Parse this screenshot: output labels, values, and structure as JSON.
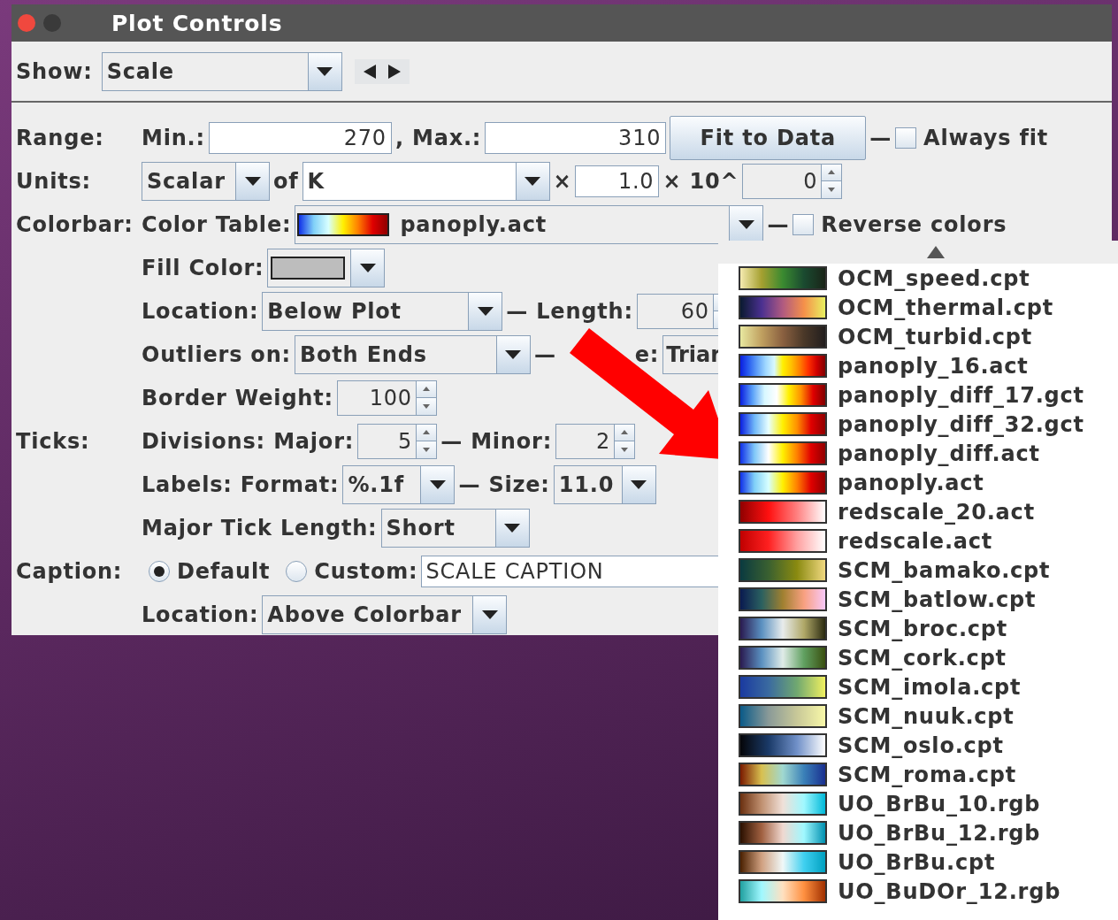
{
  "window": {
    "title": "Plot Controls"
  },
  "show": {
    "label": "Show:",
    "value": "Scale"
  },
  "rows": [
    {
      "label": "Range:",
      "items": [
        {
          "kind": "text",
          "text": "Min.:"
        },
        {
          "kind": "field",
          "value": "270"
        },
        {
          "kind": "text",
          "text": ", Max.:"
        },
        {
          "kind": "field",
          "value": "310"
        },
        {
          "kind": "button",
          "text": "Fit to Data"
        },
        {
          "kind": "text",
          "text": "—"
        },
        {
          "kind": "checkbox",
          "text": "Always fit",
          "checked": false
        }
      ]
    },
    {
      "label": "Units:",
      "items": [
        {
          "kind": "combo",
          "value": "Scalar"
        },
        {
          "kind": "text",
          "text": "of"
        },
        {
          "kind": "editcombo",
          "value": "K"
        },
        {
          "kind": "text",
          "text": "×"
        },
        {
          "kind": "field",
          "value": "1.0"
        },
        {
          "kind": "text",
          "text": "× 10^"
        },
        {
          "kind": "spinner",
          "value": "0"
        }
      ]
    },
    {
      "label": "Colorbar:",
      "items": [
        {
          "kind": "text",
          "text": "Color Table:"
        },
        {
          "kind": "tablecombo",
          "value": "panoply.act"
        },
        {
          "kind": "text",
          "text": "—"
        },
        {
          "kind": "checkbox",
          "text": "Reverse colors",
          "checked": false
        }
      ]
    },
    {
      "items": [
        {
          "kind": "text",
          "text": "Fill Color:"
        },
        {
          "kind": "colorcombo"
        }
      ]
    },
    {
      "items": [
        {
          "kind": "text",
          "text": "Location:"
        },
        {
          "kind": "combo",
          "value": "Below Plot"
        },
        {
          "kind": "text",
          "text": "— Length:"
        },
        {
          "kind": "spinner",
          "value": "60"
        }
      ]
    },
    {
      "items": [
        {
          "kind": "text",
          "text": "Outliers on:"
        },
        {
          "kind": "combo",
          "value": "Both Ends"
        },
        {
          "kind": "text",
          "text": "—"
        },
        {
          "kind": "text",
          "text": "e:"
        },
        {
          "kind": "combo",
          "value": "Triar"
        }
      ]
    },
    {
      "items": [
        {
          "kind": "text",
          "text": "Border Weight:"
        },
        {
          "kind": "spinner",
          "value": "100"
        }
      ]
    },
    {
      "label": "Ticks:",
      "items": [
        {
          "kind": "text",
          "text": "Divisions: Major:"
        },
        {
          "kind": "spinner",
          "value": "5"
        },
        {
          "kind": "text",
          "text": "— Minor:"
        },
        {
          "kind": "spinner",
          "value": "2"
        }
      ]
    },
    {
      "items": [
        {
          "kind": "text",
          "text": "Labels: Format:"
        },
        {
          "kind": "combo",
          "value": "%.1f"
        },
        {
          "kind": "text",
          "text": "— Size:"
        },
        {
          "kind": "combo",
          "value": "11.0"
        }
      ]
    },
    {
      "items": [
        {
          "kind": "text",
          "text": "Major Tick Length:"
        },
        {
          "kind": "combo",
          "value": "Short"
        }
      ]
    },
    {
      "label": "Caption:",
      "items": [
        {
          "kind": "radio",
          "text": "Default",
          "selected": true
        },
        {
          "kind": "radio",
          "text": "Custom:",
          "selected": false
        },
        {
          "kind": "field",
          "value": "SCALE CAPTION"
        }
      ]
    },
    {
      "items": [
        {
          "kind": "text",
          "text": "Location:"
        },
        {
          "kind": "combo",
          "value": "Above Colorbar"
        }
      ]
    }
  ],
  "popup": {
    "items": [
      {
        "name": "OCM_speed.cpt"
      },
      {
        "name": "OCM_thermal.cpt"
      },
      {
        "name": "OCM_turbid.cpt"
      },
      {
        "name": "panoply_16.act"
      },
      {
        "name": "panoply_diff_17.gct"
      },
      {
        "name": "panoply_diff_32.gct"
      },
      {
        "name": "panoply_diff.act"
      },
      {
        "name": "panoply.act"
      },
      {
        "name": "redscale_20.act"
      },
      {
        "name": "redscale.act"
      },
      {
        "name": "SCM_bamako.cpt"
      },
      {
        "name": "SCM_batlow.cpt"
      },
      {
        "name": "SCM_broc.cpt"
      },
      {
        "name": "SCM_cork.cpt"
      },
      {
        "name": "SCM_imola.cpt"
      },
      {
        "name": "SCM_nuuk.cpt"
      },
      {
        "name": "SCM_oslo.cpt"
      },
      {
        "name": "SCM_roma.cpt"
      },
      {
        "name": "UO_BrBu_10.rgb"
      },
      {
        "name": "UO_BrBu_12.rgb"
      },
      {
        "name": "UO_BrBu.cpt"
      },
      {
        "name": "UO_BuDOr_12.rgb"
      }
    ]
  }
}
